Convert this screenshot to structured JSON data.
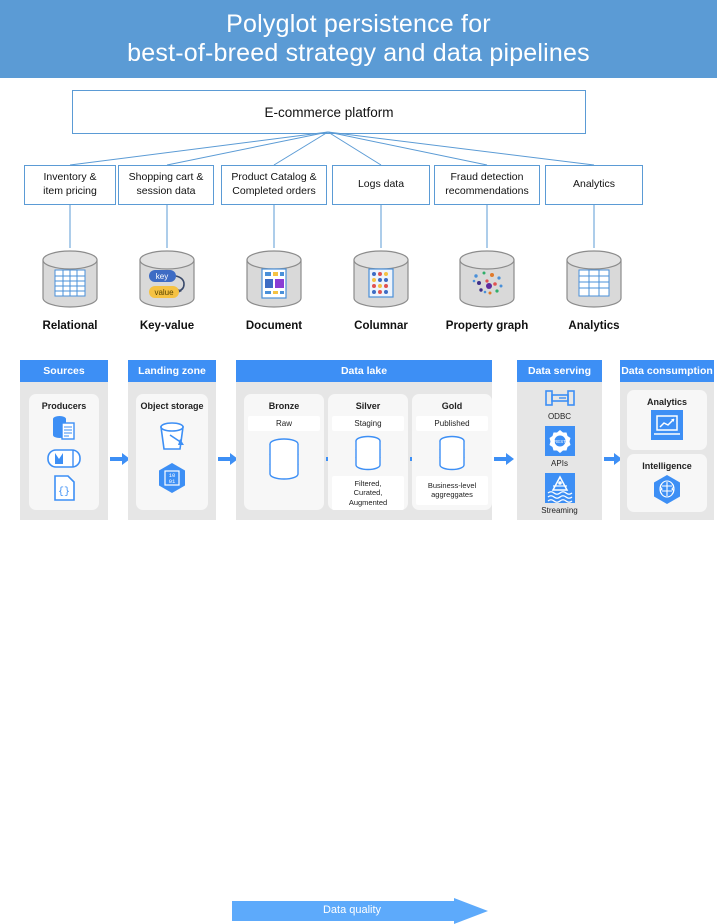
{
  "title": {
    "line1": "Polyglot persistence for",
    "line2": "best-of-breed strategy and data pipelines",
    "bar_color": "#5b9bd5"
  },
  "architecture": {
    "platform_label": "E-commerce platform",
    "categories": [
      {
        "label": "Inventory &\nitem pricing",
        "line1": "Inventory &",
        "line2": "item pricing"
      },
      {
        "label": "Shopping cart &\nsession data",
        "line1": "Shopping cart &",
        "line2": "session data"
      },
      {
        "label": "Product Catalog &\nCompleted orders",
        "line1": "Product Catalog &",
        "line2": "Completed orders"
      },
      {
        "label": "Logs data",
        "line1": "Logs data",
        "line2": ""
      },
      {
        "label": "Fraud detection\nrecommendations",
        "line1": "Fraud detection",
        "line2": "recommendations"
      },
      {
        "label": "Analytics",
        "line1": "Analytics",
        "line2": ""
      }
    ],
    "databases": [
      {
        "label": "Relational",
        "icon": "database-relational-icon"
      },
      {
        "label": "Key-value",
        "icon": "database-keyvalue-icon",
        "key_text": "key",
        "value_text": "value"
      },
      {
        "label": "Document",
        "icon": "database-document-icon"
      },
      {
        "label": "Columnar",
        "icon": "database-columnar-icon"
      },
      {
        "label": "Property graph",
        "icon": "database-graph-icon"
      },
      {
        "label": "Analytics",
        "icon": "database-analytics-icon"
      }
    ]
  },
  "pipeline": {
    "accent_color": "#3d8ff5",
    "columns": [
      {
        "header": "Sources",
        "cards": [
          {
            "title": "Producers",
            "icons": [
              "database-document-icon",
              "stream-cylinder-icon",
              "json-file-icon"
            ]
          }
        ]
      },
      {
        "header": "Landing zone",
        "cards": [
          {
            "title": "Object storage",
            "icons": [
              "bucket-icon",
              "binary-hexagon-icon"
            ]
          }
        ]
      },
      {
        "header": "Data lake",
        "cards": [
          {
            "title": "Bronze",
            "chip": "Raw",
            "note": "",
            "icons": [
              "stacked-disks-icon"
            ]
          },
          {
            "title": "Silver",
            "chip": "Staging",
            "note": "Filtered,\nCurated,\nAugmented",
            "note1": "Filtered,",
            "note2": "Curated,",
            "note3": "Augmented",
            "icons": [
              "stacked-disks-icon"
            ]
          },
          {
            "title": "Gold",
            "chip": "Published",
            "note": "Business-level\naggreggates",
            "note1": "Business-level",
            "note2": "aggreggates",
            "note3": "",
            "icons": [
              "stacked-disks-icon"
            ]
          }
        ]
      },
      {
        "header": "Data serving",
        "items": [
          {
            "label": "ODBC",
            "icon": "odbc-connector-icon"
          },
          {
            "label": "APIs",
            "icon": "api-gear-icon"
          },
          {
            "label": "Streaming",
            "icon": "streaming-buoy-icon"
          }
        ]
      },
      {
        "header": "Data consumption",
        "cards": [
          {
            "title": "Analytics",
            "icons": [
              "laptop-chart-icon"
            ]
          },
          {
            "title": "Intelligence",
            "icons": [
              "brain-hexagon-icon"
            ]
          }
        ]
      }
    ],
    "data_quality_label": "Data quality"
  }
}
